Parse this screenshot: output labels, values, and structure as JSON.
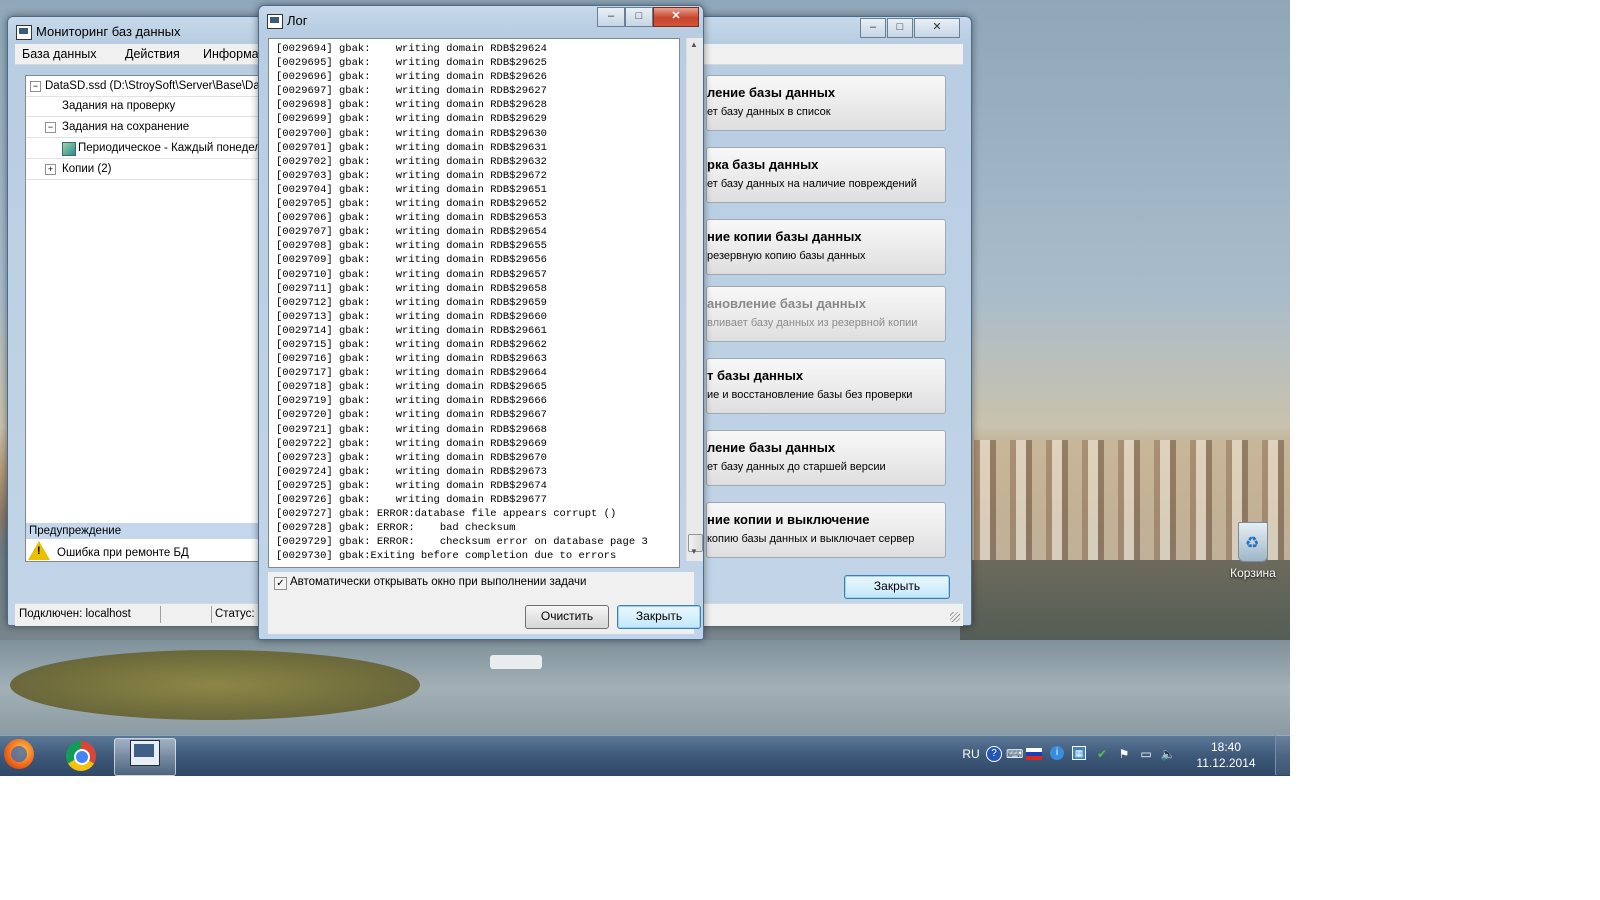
{
  "desktop": {
    "recycle_bin_label": "Корзина"
  },
  "main_window": {
    "title": "Мониторинг баз данных",
    "menu": [
      "База данных",
      "Действия",
      "Информац"
    ],
    "tree": {
      "root": "DataSD.ssd (D:\\StroySoft\\Server\\Base\\Data",
      "tasks_check": "Задания на проверку",
      "tasks_save": "Задания на сохранение",
      "periodic": "Периодическое - Каждый понедель",
      "copies": "Копии (2)"
    },
    "warning": {
      "header": "Предупреждение",
      "message": "Ошибка при ремонте БД"
    },
    "actions": [
      {
        "title": "ление базы данных",
        "desc": "ет базу данных в список",
        "enabled": true
      },
      {
        "title": "рка базы данных",
        "desc": "ет базу данных на наличие повреждений",
        "enabled": true
      },
      {
        "title": "ние копии базы данных",
        "desc": "резервную копию базы данных",
        "enabled": true
      },
      {
        "title": "ановление базы данных",
        "desc": "вливает базу данных из резервной копии",
        "enabled": false
      },
      {
        "title": "т базы данных",
        "desc": "ие и восстановление базы без проверки",
        "enabled": true
      },
      {
        "title": "ление базы данных",
        "desc": "ет базу данных до старшей версии",
        "enabled": true
      },
      {
        "title": "ние копии и выключение",
        "desc": "копию базы данных и выключает сервер",
        "enabled": true
      }
    ],
    "close_button": "Закрыть",
    "status": {
      "connected": "Подключен: localhost",
      "status": "Статус: О"
    }
  },
  "log_window": {
    "title": "Лог",
    "lines": [
      "[0029694] gbak:    writing domain RDB$29624",
      "[0029695] gbak:    writing domain RDB$29625",
      "[0029696] gbak:    writing domain RDB$29626",
      "[0029697] gbak:    writing domain RDB$29627",
      "[0029698] gbak:    writing domain RDB$29628",
      "[0029699] gbak:    writing domain RDB$29629",
      "[0029700] gbak:    writing domain RDB$29630",
      "[0029701] gbak:    writing domain RDB$29631",
      "[0029702] gbak:    writing domain RDB$29632",
      "[0029703] gbak:    writing domain RDB$29672",
      "[0029704] gbak:    writing domain RDB$29651",
      "[0029705] gbak:    writing domain RDB$29652",
      "[0029706] gbak:    writing domain RDB$29653",
      "[0029707] gbak:    writing domain RDB$29654",
      "[0029708] gbak:    writing domain RDB$29655",
      "[0029709] gbak:    writing domain RDB$29656",
      "[0029710] gbak:    writing domain RDB$29657",
      "[0029711] gbak:    writing domain RDB$29658",
      "[0029712] gbak:    writing domain RDB$29659",
      "[0029713] gbak:    writing domain RDB$29660",
      "[0029714] gbak:    writing domain RDB$29661",
      "[0029715] gbak:    writing domain RDB$29662",
      "[0029716] gbak:    writing domain RDB$29663",
      "[0029717] gbak:    writing domain RDB$29664",
      "[0029718] gbak:    writing domain RDB$29665",
      "[0029719] gbak:    writing domain RDB$29666",
      "[0029720] gbak:    writing domain RDB$29667",
      "[0029721] gbak:    writing domain RDB$29668",
      "[0029722] gbak:    writing domain RDB$29669",
      "[0029723] gbak:    writing domain RDB$29670",
      "[0029724] gbak:    writing domain RDB$29673",
      "[0029725] gbak:    writing domain RDB$29674",
      "[0029726] gbak:    writing domain RDB$29677",
      "[0029727] gbak: ERROR:database file appears corrupt ()",
      "[0029728] gbak: ERROR:    bad checksum",
      "[0029729] gbak: ERROR:    checksum error on database page 3",
      "[0029730] gbak:Exiting before completion due to errors"
    ],
    "auto_open_checked": true,
    "auto_open_label": "Автоматически открывать окно при  выполнении задачи",
    "clear_button": "Очистить",
    "close_button": "Закрыть"
  },
  "taskbar": {
    "language": "RU",
    "time": "18:40",
    "date": "11.12.2014"
  }
}
